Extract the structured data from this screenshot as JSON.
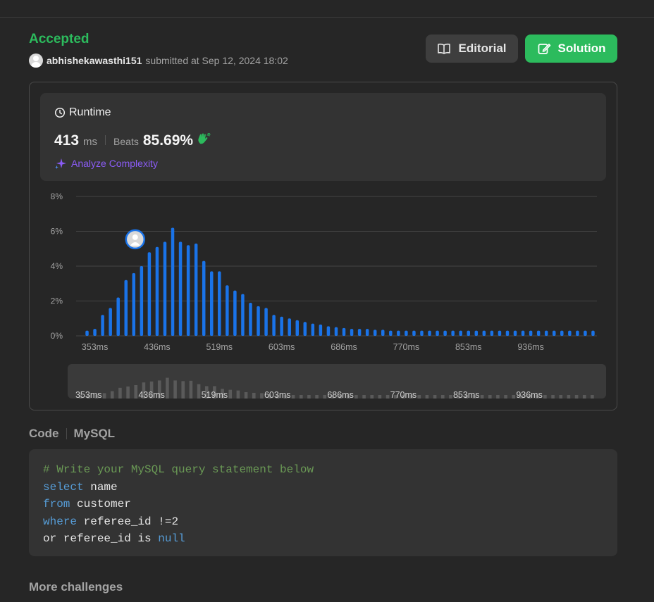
{
  "submission": {
    "status": "Accepted",
    "username": "abhishekawasthi151",
    "submitted_text": "submitted at Sep 12, 2024 18:02"
  },
  "actions": {
    "editorial_label": "Editorial",
    "solution_label": "Solution"
  },
  "runtime": {
    "title": "Runtime",
    "value": "413",
    "unit": "ms",
    "beats_label": "Beats",
    "beats_value": "85.69%",
    "analyze_label": "Analyze Complexity"
  },
  "colors": {
    "accent_green": "#2cbb5d",
    "bar_blue": "#1a73e8",
    "analyze_purple": "#8b5cf6"
  },
  "chart_data": {
    "type": "bar",
    "ylim": [
      0,
      8
    ],
    "y_ticks": [
      "0%",
      "2%",
      "4%",
      "6%",
      "8%"
    ],
    "x_tick_labels": [
      "353ms",
      "436ms",
      "519ms",
      "603ms",
      "686ms",
      "770ms",
      "853ms",
      "936ms"
    ],
    "x_tick_bar_index": [
      1,
      9,
      17,
      25,
      33,
      41,
      49,
      57
    ],
    "user_bar_index": 6,
    "values": [
      0.3,
      0.4,
      1.2,
      1.6,
      2.2,
      3.2,
      3.6,
      4.0,
      4.8,
      5.1,
      5.4,
      6.2,
      5.4,
      5.2,
      5.3,
      4.3,
      3.7,
      3.7,
      2.9,
      2.6,
      2.4,
      1.9,
      1.7,
      1.6,
      1.2,
      1.1,
      1.0,
      0.9,
      0.8,
      0.7,
      0.65,
      0.55,
      0.5,
      0.45,
      0.4,
      0.4,
      0.4,
      0.35,
      0.35,
      0.3,
      0.3,
      0.3,
      0.3,
      0.3,
      0.3,
      0.3,
      0.3,
      0.3,
      0.3,
      0.3,
      0.3,
      0.3,
      0.3,
      0.3,
      0.3,
      0.3,
      0.3,
      0.3,
      0.3,
      0.3,
      0.3,
      0.3,
      0.3,
      0.3,
      0.3,
      0.3
    ]
  },
  "code": {
    "tab_code": "Code",
    "language": "MySQL",
    "lines": [
      [
        {
          "t": "comment",
          "s": "# Write your MySQL query statement below"
        }
      ],
      [
        {
          "t": "kw",
          "s": "select"
        },
        {
          "t": "plain",
          "s": " name"
        }
      ],
      [
        {
          "t": "kw",
          "s": "from"
        },
        {
          "t": "plain",
          "s": " customer"
        }
      ],
      [
        {
          "t": "kw",
          "s": "where"
        },
        {
          "t": "plain",
          "s": " referee_id !=2"
        }
      ],
      [
        {
          "t": "plain",
          "s": "or referee_id is "
        },
        {
          "t": "kw",
          "s": "null"
        }
      ]
    ]
  },
  "more_challenges_label": "More challenges"
}
